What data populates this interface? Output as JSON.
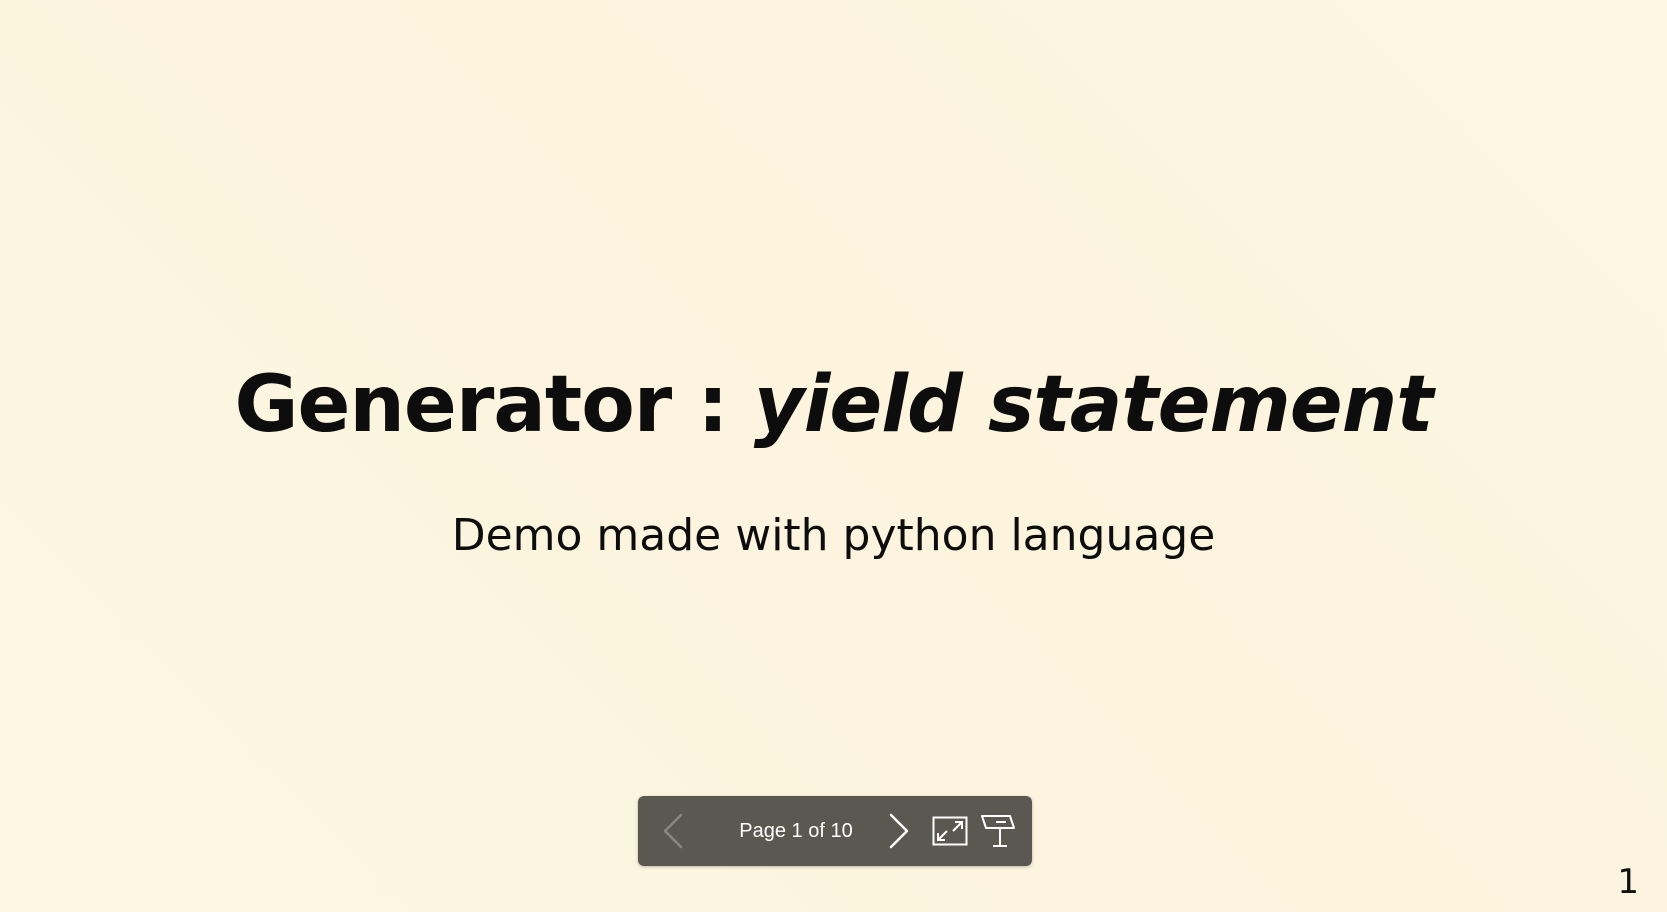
{
  "slide": {
    "title_main": "Generator : ",
    "title_emphasis": "yield statement",
    "subtitle": "Demo made with python language",
    "page_number": "1"
  },
  "toolbar": {
    "page_label": "Page 1 of 10",
    "current_page": 1,
    "total_pages": 10,
    "icons": {
      "prev": "chevron-left-icon",
      "next": "chevron-right-icon",
      "fullscreen": "fullscreen-icon",
      "presenter": "presenter-mode-icon"
    }
  },
  "colors": {
    "background": "#fcf5de",
    "text": "#0d0d0d",
    "toolbar_bg": "#5b5852",
    "toolbar_fg": "#ffffff",
    "toolbar_disabled": "#8a8680"
  }
}
